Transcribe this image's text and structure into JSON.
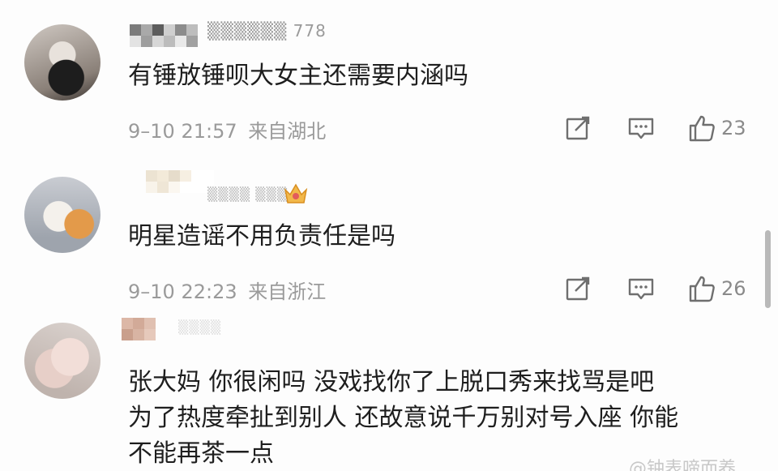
{
  "comments": [
    {
      "username": "▒▒▒▒▒▒ 778",
      "text": "有锤放锤呗大女主还需要内涵吗",
      "time": "9–10 21:57",
      "location": "来自湖北",
      "likes": "23"
    },
    {
      "username": "▒▒▒▒ ▒▒▒ v",
      "text": "明星造谣不用负责任是吗",
      "time": "9–10 22:23",
      "location": "来自浙江",
      "likes": "26"
    },
    {
      "username": "▒▒▒▒",
      "text_lines": [
        "张大妈 你很闲吗 没戏找你了上脱口秀来找骂是吧",
        "为了热度牵扯到别人 还故意说千万别对号入座 你能",
        "不能再茶一点"
      ]
    }
  ],
  "icons": {
    "share": "share-icon",
    "comment": "comment-icon",
    "like": "thumbs-up-icon",
    "badge": "crown-badge-icon"
  },
  "watermark": "@钟表啼而养",
  "colors": {
    "text": "#1e1e1e",
    "meta": "#9a9a9a",
    "icon": "#6f6f6f",
    "badge": "#e8a33a"
  }
}
